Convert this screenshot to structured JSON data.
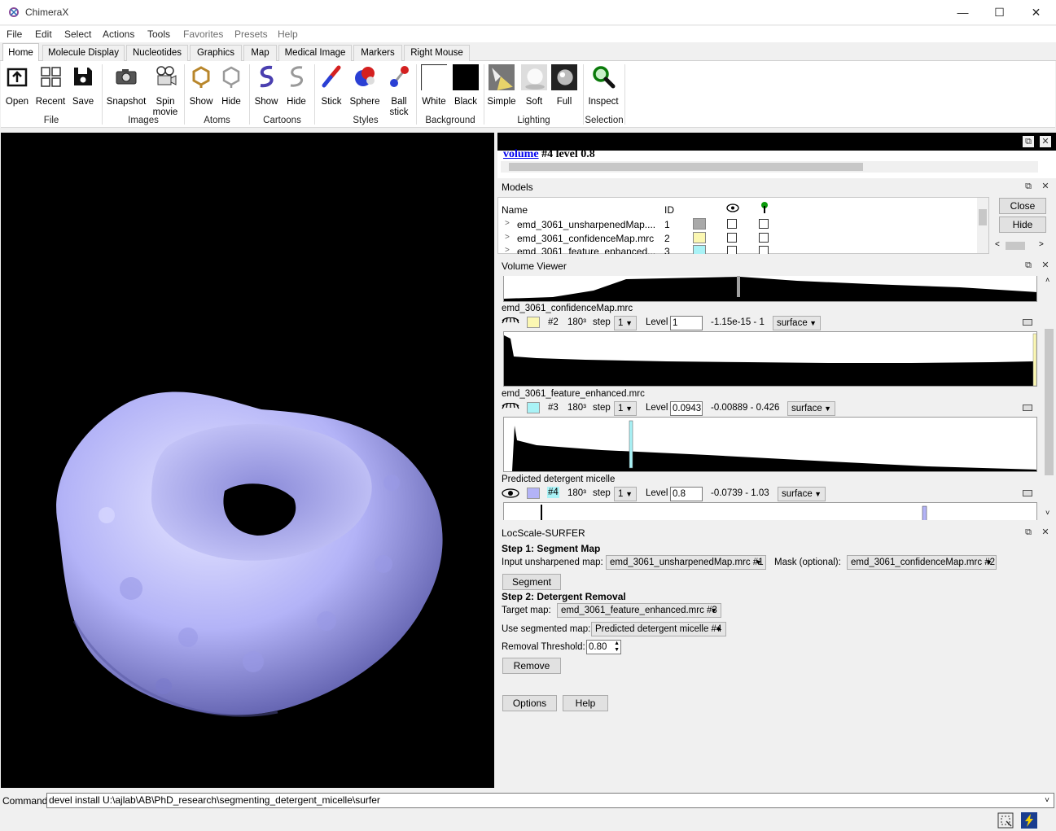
{
  "window": {
    "title": "ChimeraX",
    "minimize": "—",
    "maximize": "☐",
    "close": "✕"
  },
  "menu": [
    "File",
    "Edit",
    "Select",
    "Actions",
    "Tools",
    "Favorites",
    "Presets",
    "Help"
  ],
  "tabs": [
    "Home",
    "Molecule Display",
    "Nucleotides",
    "Graphics",
    "Map",
    "Medical Image",
    "Markers",
    "Right Mouse"
  ],
  "ribbon": {
    "buttons": [
      {
        "label": "Open",
        "icon": "open-icon"
      },
      {
        "label": "Recent",
        "icon": "recent-icon"
      },
      {
        "label": "Save",
        "icon": "save-icon"
      },
      {
        "label": "Snapshot",
        "icon": "camera-icon"
      },
      {
        "label": "Spin",
        "label2": "movie",
        "icon": "movie-camera-icon"
      },
      {
        "label": "Show",
        "icon": "atom-show-icon"
      },
      {
        "label": "Hide",
        "icon": "atom-hide-icon"
      },
      {
        "label": "Show",
        "icon": "cartoon-show-icon"
      },
      {
        "label": "Hide",
        "icon": "cartoon-hide-icon"
      },
      {
        "label": "Stick",
        "icon": "stick-icon"
      },
      {
        "label": "Sphere",
        "icon": "sphere-icon"
      },
      {
        "label": "Ball",
        "label2": "stick",
        "icon": "ball-stick-icon"
      },
      {
        "label": "White",
        "icon": "white-bg-icon"
      },
      {
        "label": "Black",
        "icon": "black-bg-icon"
      },
      {
        "label": "Simple",
        "icon": "simple-light-icon"
      },
      {
        "label": "Soft",
        "icon": "soft-light-icon"
      },
      {
        "label": "Full",
        "icon": "full-light-icon"
      },
      {
        "label": "Inspect",
        "icon": "magnifier-icon"
      }
    ],
    "groups": [
      "File",
      "Images",
      "Atoms",
      "Cartoons",
      "Styles",
      "Background",
      "Lighting",
      "Selection"
    ]
  },
  "log": {
    "link": "volume",
    "rest": " #4 level 0.8"
  },
  "models": {
    "title": "Models",
    "headers": {
      "name": "Name",
      "id": "ID"
    },
    "rows": [
      {
        "name": "emd_3061_unsharpenedMap....",
        "id": "1",
        "color": "#a9a9a9"
      },
      {
        "name": "emd_3061_confidenceMap.mrc",
        "id": "2",
        "color": "#fbf7b2"
      },
      {
        "name": "emd_3061_feature_enhanced...",
        "id": "3",
        "color": "#a9f2f6"
      }
    ],
    "close_button": "Close",
    "hide_button": "Hide"
  },
  "volume_viewer": {
    "title": "Volume Viewer",
    "maps": [
      {
        "name": "emd_3061_confidenceMap.mrc",
        "id": "#2",
        "size": "180³",
        "step_label": "step",
        "step": "1",
        "level_label": "Level",
        "level": "1",
        "range": "-1.15e-15 - 1",
        "style": "surface",
        "color": "#fbf7b2"
      },
      {
        "name": "emd_3061_feature_enhanced.mrc",
        "id": "#3",
        "size": "180³",
        "step_label": "step",
        "step": "1",
        "level_label": "Level",
        "level": "0.0943",
        "range": "-0.00889 - 0.426",
        "style": "surface",
        "color": "#a9f2f6"
      },
      {
        "name": "Predicted detergent micelle",
        "id": "#4",
        "size": "180³",
        "step_label": "step",
        "step": "1",
        "level_label": "Level",
        "level": "0.8",
        "range": "-0.0739 - 1.03",
        "style": "surface",
        "color": "#b3b3f7"
      }
    ]
  },
  "surfer": {
    "title": "LocScale-SURFER",
    "step1": "Step 1: Segment Map",
    "input_label": "Input unsharpened map:",
    "input_value": "emd_3061_unsharpenedMap.mrc #1",
    "mask_label": "Mask (optional):",
    "mask_value": "emd_3061_confidenceMap.mrc #2",
    "segment_button": "Segment",
    "step2": "Step 2: Detergent Removal",
    "target_label": "Target map:",
    "target_value": "emd_3061_feature_enhanced.mrc #3",
    "segmented_label": "Use segmented map:",
    "segmented_value": "Predicted detergent micelle #4",
    "threshold_label": "Removal Threshold:",
    "threshold_value": "0.80",
    "remove_button": "Remove",
    "options_button": "Options",
    "help_button": "Help"
  },
  "command": {
    "label": "Command:",
    "value": "devel install U:\\ajlab\\AB\\PhD_research\\segmenting_detergent_micelle\\surfer"
  },
  "colors": {
    "accent": "#0078d7",
    "surface": "#b3b3f7",
    "link": "#0000ee"
  }
}
